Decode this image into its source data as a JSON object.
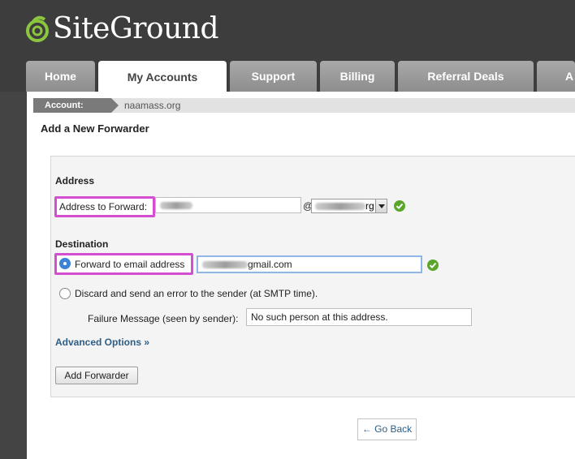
{
  "brand": {
    "name": "SiteGround",
    "logo_color": "#8cc63e"
  },
  "tabs": [
    {
      "label": "Home",
      "active": false
    },
    {
      "label": "My Accounts",
      "active": true
    },
    {
      "label": "Support",
      "active": false
    },
    {
      "label": "Billing",
      "active": false
    },
    {
      "label": "Referral Deals",
      "active": false
    },
    {
      "label": "A",
      "active": false
    }
  ],
  "breadcrumb": {
    "account_label": "Account:",
    "domain": "naamass.org"
  },
  "page": {
    "title": "Add a New Forwarder"
  },
  "form": {
    "address_heading": "Address",
    "address_label": "Address to Forward:",
    "at_sign": "@",
    "domain_select_suffix": "rg",
    "destination_heading": "Destination",
    "forward_label": "Forward to email address",
    "forward_value_suffix": "gmail.com",
    "discard_label": "Discard and send an error to the sender (at SMTP time).",
    "failure_label": "Failure Message (seen by sender):",
    "failure_value": "No such person at this address.",
    "advanced_link": "Advanced Options »",
    "submit_label": "Add Forwarder"
  },
  "footer": {
    "go_back": "← Go Back"
  },
  "colors": {
    "highlight": "#d44fd0",
    "accent_link": "#2e5d86",
    "check_green": "#5aa62c"
  }
}
